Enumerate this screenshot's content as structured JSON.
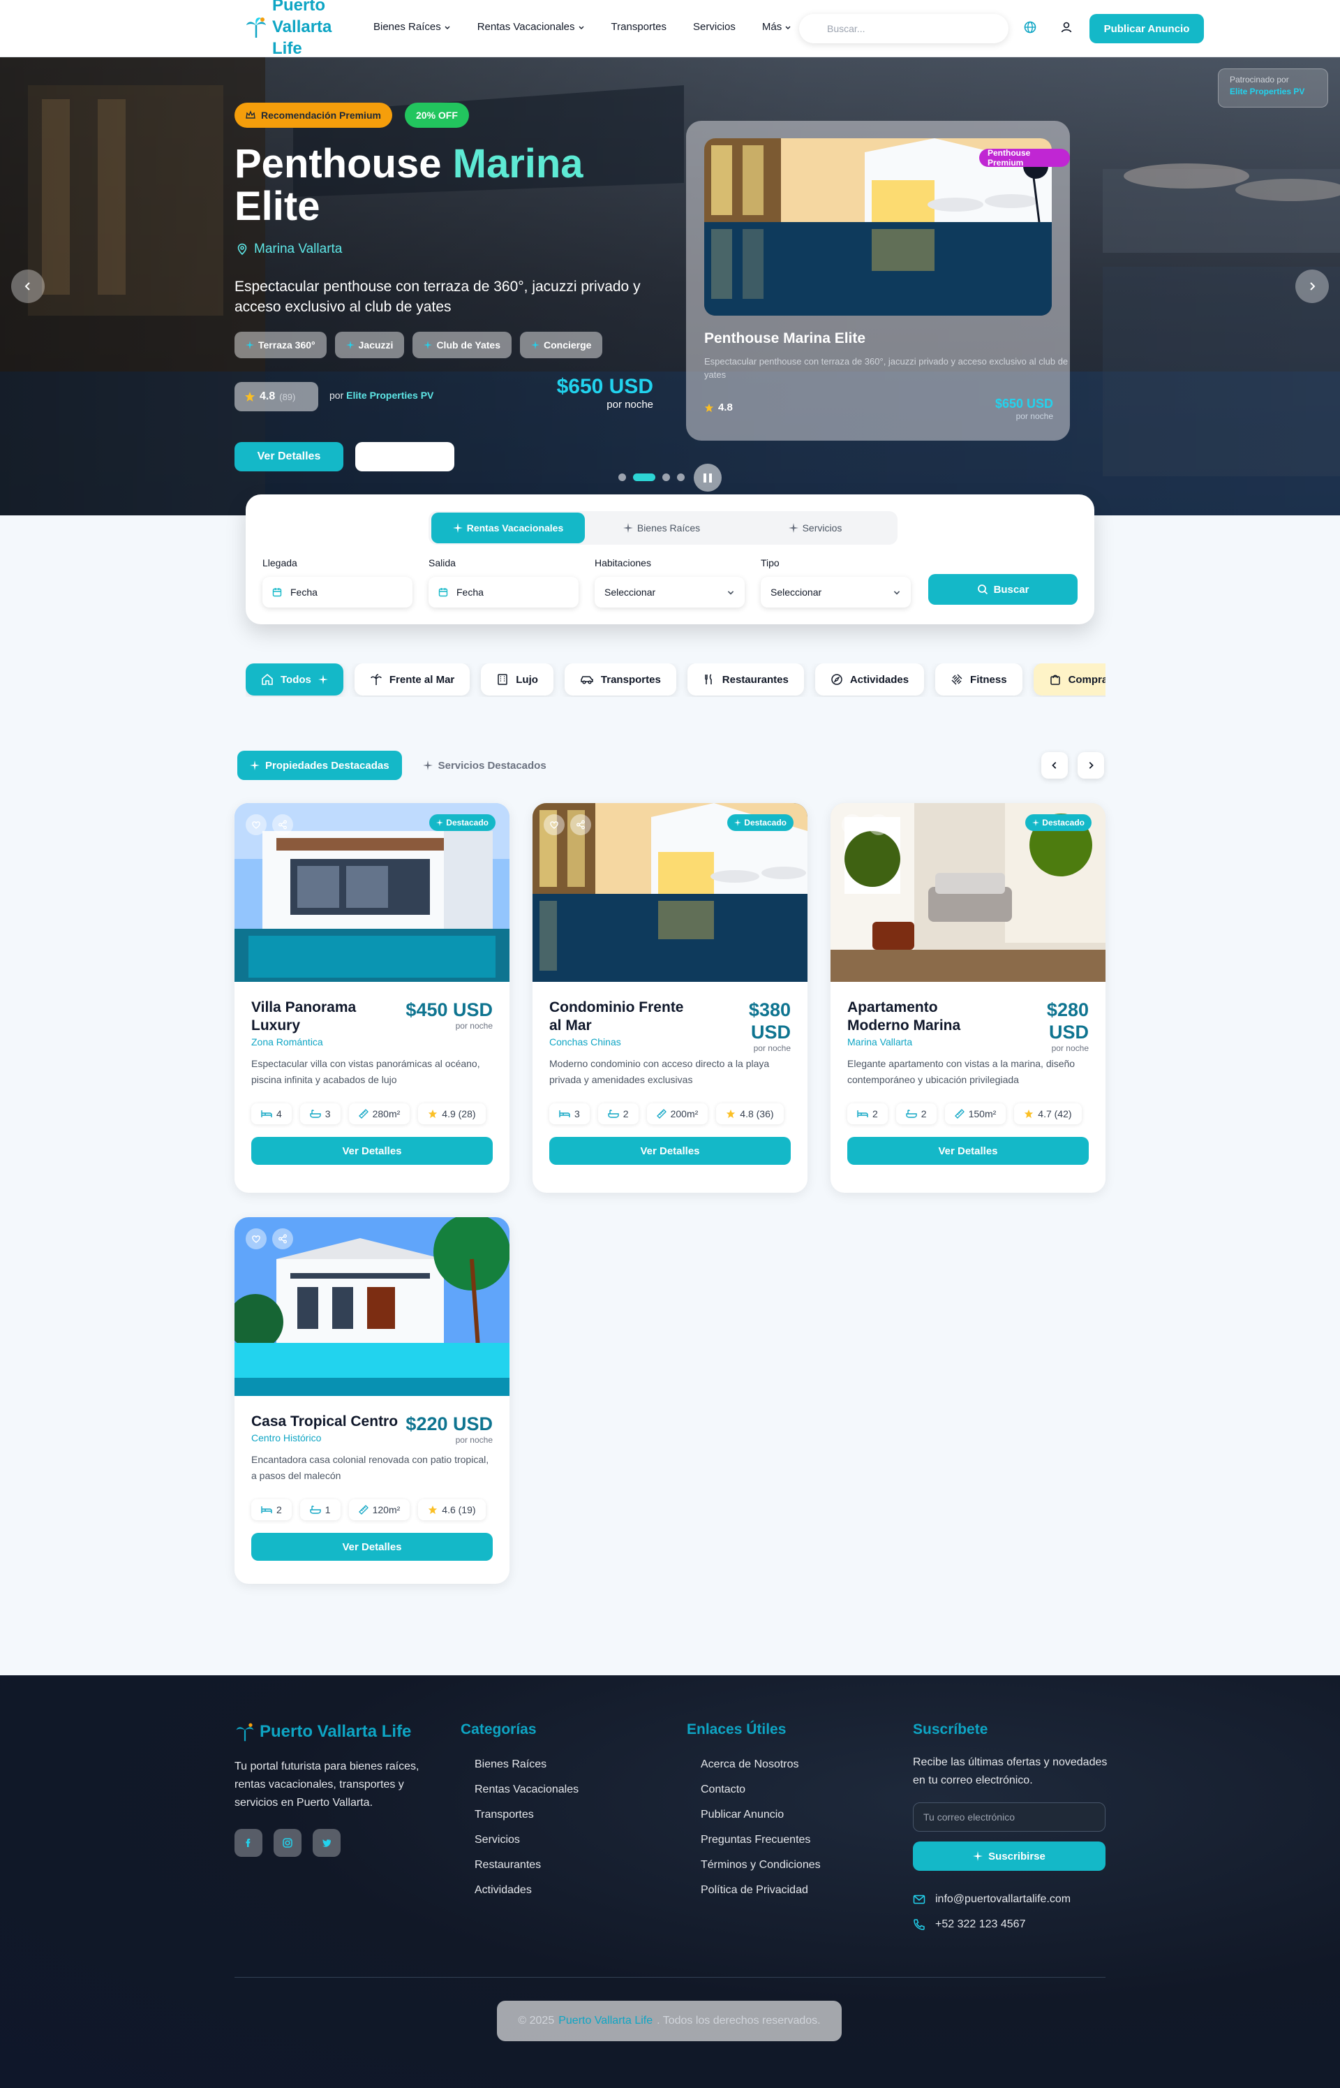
{
  "header": {
    "logo_line1": "Puerto",
    "logo_line2": "Vallarta",
    "logo_line3": "Life",
    "nav": [
      "Bienes Raíces",
      "Rentas Vacacionales",
      "Transportes",
      "Servicios",
      "Más"
    ],
    "search_placeholder": "Buscar...",
    "publish_label": "Publicar Anuncio"
  },
  "hero": {
    "badge_premium": "Recomendación Premium",
    "badge_off": "20% OFF",
    "title_line1": "Penthouse",
    "title_accent": "Marina",
    "title_line2": "Elite",
    "location": "Marina Vallarta",
    "description": "Espectacular penthouse con terraza de 360°, jacuzzi privado y acceso exclusivo al club de yates",
    "amenities": [
      "Terraza 360°",
      "Jacuzzi",
      "Club de Yates",
      "Concierge"
    ],
    "rating": "4.8",
    "rating_count": "(89)",
    "by_prefix": "por",
    "by_agent": "Elite Properties PV",
    "price": "$650 USD",
    "per": "por noche",
    "details_label": "Ver Detalles",
    "slide_index": 2,
    "slide_count": 4,
    "sponsor_label": "Patrocinado por",
    "sponsor_name": "Elite Properties PV",
    "card": {
      "badge": "Penthouse Premium",
      "title": "Penthouse Marina Elite",
      "description": "Espectacular penthouse con terraza de 360°, jacuzzi privado y acceso exclusivo al club de yates",
      "rating": "4.8",
      "price": "$650 USD",
      "per": "por noche"
    }
  },
  "search_box": {
    "tabs": [
      "Rentas Vacacionales",
      "Bienes Raíces",
      "Servicios"
    ],
    "active_tab": "Rentas Vacacionales",
    "fields": [
      {
        "label": "Llegada",
        "value": "Fecha"
      },
      {
        "label": "Salida",
        "value": "Fecha"
      },
      {
        "label": "Habitaciones",
        "value": "Seleccionar"
      },
      {
        "label": "Tipo",
        "value": "Seleccionar"
      }
    ],
    "search_label": "Buscar"
  },
  "categories": [
    "Todos",
    "Frente al Mar",
    "Lujo",
    "Transportes",
    "Restaurantes",
    "Actividades",
    "Fitness",
    "Compras"
  ],
  "featured_tabs": [
    "Propiedades Destacadas",
    "Servicios Destacados"
  ],
  "featured_badge": "Destacado",
  "listings": [
    {
      "title": "Villa Panorama Luxury",
      "zone": "Zona Romántica",
      "price": "$450 USD",
      "per": "por noche",
      "description": "Espectacular villa con vistas panorámicas al océano, piscina infinita y acabados de lujo",
      "beds": "4",
      "baths": "3",
      "area": "280m²",
      "rating": "4.9 (28)",
      "featured": true,
      "button": "Ver Detalles"
    },
    {
      "title": "Condominio Frente al Mar",
      "zone": "Conchas Chinas",
      "price": "$380 USD",
      "per": "por noche",
      "description": "Moderno condominio con acceso directo a la playa privada y amenidades exclusivas",
      "beds": "3",
      "baths": "2",
      "area": "200m²",
      "rating": "4.8 (36)",
      "featured": true,
      "button": "Ver Detalles"
    },
    {
      "title": "Apartamento Moderno Marina",
      "zone": "Marina Vallarta",
      "price": "$280 USD",
      "per": "por noche",
      "description": "Elegante apartamento con vistas a la marina, diseño contemporáneo y ubicación privilegiada",
      "beds": "2",
      "baths": "2",
      "area": "150m²",
      "rating": "4.7 (42)",
      "featured": true,
      "button": "Ver Detalles"
    },
    {
      "title": "Casa Tropical Centro",
      "zone": "Centro Histórico",
      "price": "$220 USD",
      "per": "por noche",
      "description": "Encantadora casa colonial renovada con patio tropical, a pasos del malecón",
      "beds": "2",
      "baths": "1",
      "area": "120m²",
      "rating": "4.6 (19)",
      "featured": false,
      "button": "Ver Detalles"
    }
  ],
  "footer": {
    "brand": "Puerto Vallarta Life",
    "about": "Tu portal futurista para bienes raíces, rentas vacacionales, transportes y servicios en Puerto Vallarta.",
    "categories_title": "Categorías",
    "categories": [
      "Bienes Raíces",
      "Rentas Vacacionales",
      "Transportes",
      "Servicios",
      "Restaurantes",
      "Actividades"
    ],
    "links_title": "Enlaces Útiles",
    "links": [
      "Acerca de Nosotros",
      "Contacto",
      "Publicar Anuncio",
      "Preguntas Frecuentes",
      "Términos y Condiciones",
      "Política de Privacidad"
    ],
    "subscribe_title": "Suscríbete",
    "subscribe_text": "Recibe las últimas ofertas y novedades en tu correo electrónico.",
    "email_placeholder": "Tu correo electrónico",
    "subscribe_button": "Suscribirse",
    "email": "info@puertovallartalife.com",
    "phone": "+52 322 123 4567",
    "copy_prefix": "© 2025",
    "copy_brand": "Puerto Vallarta Life",
    "copy_suffix": ". Todos los derechos reservados."
  },
  "colors": {
    "accent": "#14b8c8",
    "brand": "#0ea5c4",
    "gold": "#f59e0b",
    "green": "#22c55e",
    "magenta": "#c026d3",
    "footer_bg": "#111827"
  }
}
